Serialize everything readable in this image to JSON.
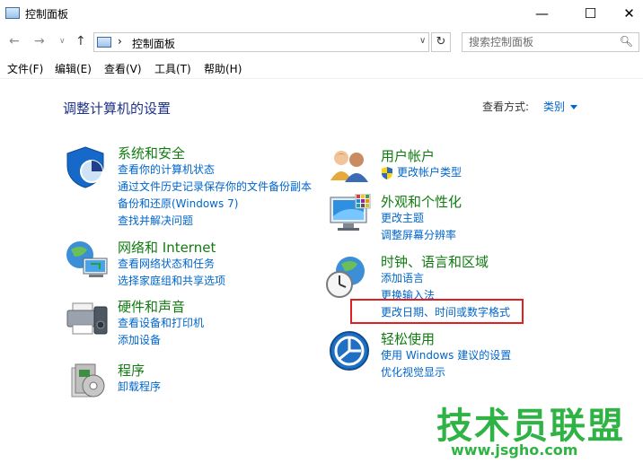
{
  "window": {
    "title": "控制面板"
  },
  "nav": {
    "breadcrumb_sep": "›",
    "breadcrumb": "控制面板",
    "search_placeholder": "搜索控制面板"
  },
  "menu": [
    "文件(F)",
    "编辑(E)",
    "查看(V)",
    "工具(T)",
    "帮助(H)"
  ],
  "main": {
    "heading": "调整计算机的设置",
    "view_by_label": "查看方式:",
    "view_by_value": "类别"
  },
  "categories": {
    "security": {
      "title": "系统和安全",
      "links": [
        "查看你的计算机状态",
        "通过文件历史记录保存你的文件备份副本",
        "备份和还原(Windows 7)",
        "查找并解决问题"
      ]
    },
    "network": {
      "title": "网络和 Internet",
      "links": [
        "查看网络状态和任务",
        "选择家庭组和共享选项"
      ]
    },
    "hardware": {
      "title": "硬件和声音",
      "links": [
        "查看设备和打印机",
        "添加设备"
      ]
    },
    "programs": {
      "title": "程序",
      "links": [
        "卸载程序"
      ]
    },
    "accounts": {
      "title": "用户帐户",
      "links": [
        "更改帐户类型"
      ]
    },
    "appearance": {
      "title": "外观和个性化",
      "links": [
        "更改主题",
        "调整屏幕分辨率"
      ]
    },
    "clock": {
      "title": "时钟、语言和区域",
      "links": [
        "添加语言",
        "更换输入法",
        "更改日期、时间或数字格式"
      ]
    },
    "ease": {
      "title": "轻松使用",
      "links": [
        "使用 Windows 建议的设置",
        "优化视觉显示"
      ]
    }
  },
  "watermark": {
    "brand": "技术员联盟",
    "url": "www.jsgho.com"
  },
  "colors": {
    "link": "#0066cc",
    "category": "#107c10",
    "heading": "#1e3287",
    "highlight": "#e02020",
    "watermark": "#2fb344"
  }
}
